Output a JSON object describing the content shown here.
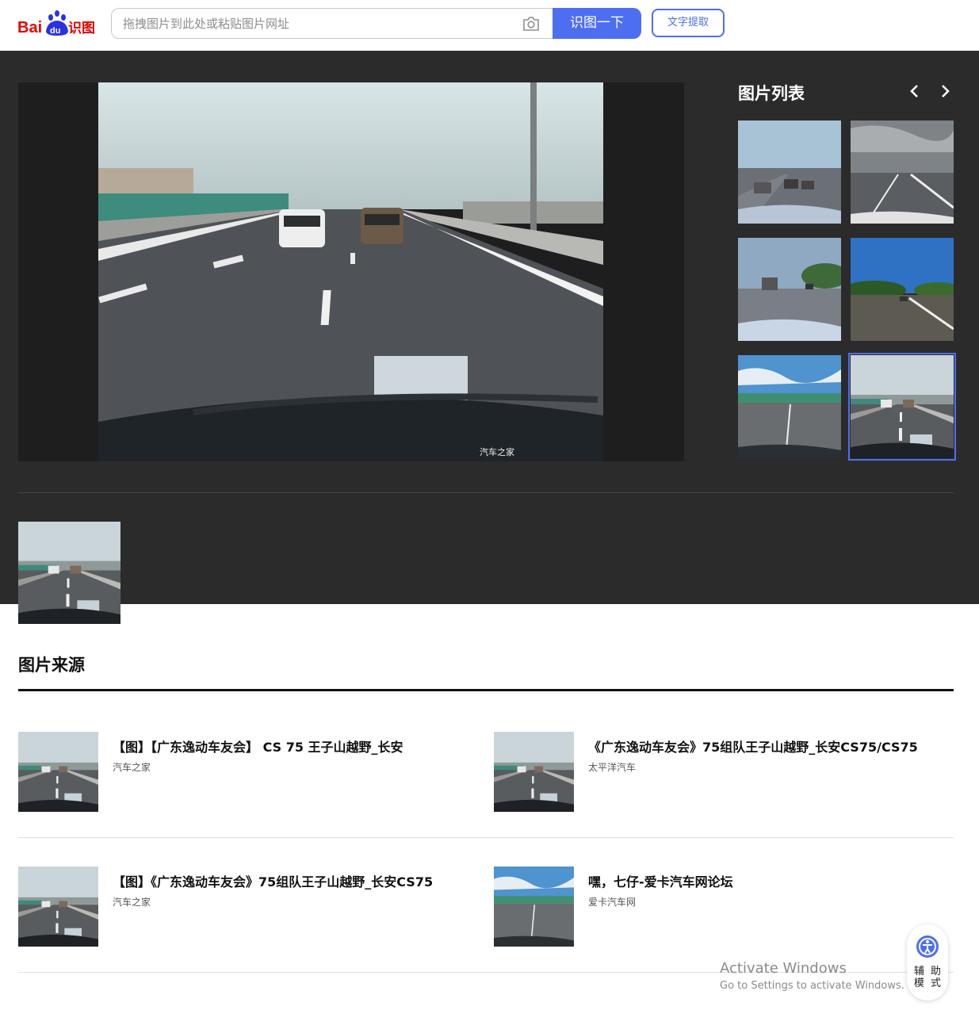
{
  "header": {
    "logo_text": "Bai识图",
    "search_placeholder": "拖拽图片到此处或粘贴图片网址",
    "search_button": "识图一下",
    "ocr_button": "文字提取"
  },
  "viewer": {
    "watermark": "汽车之家",
    "list_title": "图片列表",
    "thumbnails_count": 6,
    "selected_thumbnail": 6
  },
  "sources": {
    "title": "图片来源",
    "items": [
      {
        "title": "【图】【广东逸动车友会】 CS 75 王子山越野_长安",
        "site": "汽车之家"
      },
      {
        "title": "《广东逸动车友会》75组队王子山越野_长安CS75/CS75",
        "site": "太平洋汽车"
      },
      {
        "title": "【图】《广东逸动车友会》75组队王子山越野_长安CS75",
        "site": "汽车之家"
      },
      {
        "title": "嘿，七仔-爱卡汽车网论坛",
        "site": "爱卡汽车网"
      }
    ]
  },
  "overlay": {
    "activate_line1": "Activate Windows",
    "activate_line2": "Go to Settings to activate Windows.",
    "assist_label": "辅 助 模 式"
  },
  "colors": {
    "accent": "#4e6ef2",
    "dark_bg": "#2b2b2b",
    "logo_red": "#e10602"
  }
}
